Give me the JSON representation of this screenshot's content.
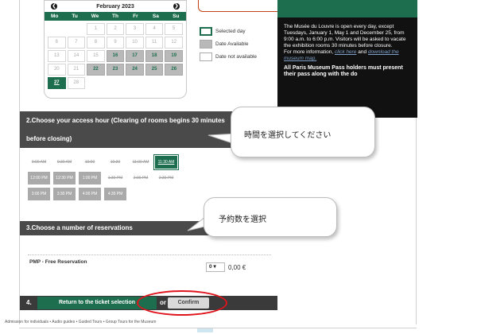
{
  "calendar": {
    "month_title": "February 2023",
    "prev_glyph": "❮",
    "next_glyph": "❯",
    "days_of_week": [
      "Mo",
      "Tu",
      "We",
      "Th",
      "Fr",
      "Sa",
      "Su"
    ],
    "weeks": [
      [
        {
          "d": "",
          "s": "blank"
        },
        {
          "d": "",
          "s": "blank"
        },
        {
          "d": "1",
          "s": "na"
        },
        {
          "d": "2",
          "s": "na"
        },
        {
          "d": "3",
          "s": "na"
        },
        {
          "d": "4",
          "s": "na"
        },
        {
          "d": "5",
          "s": "na"
        }
      ],
      [
        {
          "d": "6",
          "s": "na"
        },
        {
          "d": "7",
          "s": "na"
        },
        {
          "d": "8",
          "s": "na"
        },
        {
          "d": "9",
          "s": "na"
        },
        {
          "d": "10",
          "s": "na"
        },
        {
          "d": "11",
          "s": "na"
        },
        {
          "d": "12",
          "s": "na"
        }
      ],
      [
        {
          "d": "13",
          "s": "na"
        },
        {
          "d": "14",
          "s": "na"
        },
        {
          "d": "15",
          "s": "na"
        },
        {
          "d": "16",
          "s": "avail"
        },
        {
          "d": "17",
          "s": "avail"
        },
        {
          "d": "18",
          "s": "avail"
        },
        {
          "d": "19",
          "s": "avail"
        }
      ],
      [
        {
          "d": "20",
          "s": "na"
        },
        {
          "d": "21",
          "s": "na"
        },
        {
          "d": "22",
          "s": "avail"
        },
        {
          "d": "23",
          "s": "avail"
        },
        {
          "d": "24",
          "s": "avail"
        },
        {
          "d": "25",
          "s": "avail"
        },
        {
          "d": "26",
          "s": "avail"
        }
      ],
      [
        {
          "d": "27",
          "s": "sel"
        },
        {
          "d": "28",
          "s": "na"
        },
        {
          "d": "",
          "s": "blank"
        },
        {
          "d": "",
          "s": "blank"
        },
        {
          "d": "",
          "s": "blank"
        },
        {
          "d": "",
          "s": "blank"
        },
        {
          "d": "",
          "s": "blank"
        }
      ]
    ]
  },
  "legend": {
    "selected": "Selected day",
    "available": "Date Available",
    "not_available": "Date not available"
  },
  "info_panel": {
    "text": "The Musée du Louvre is open every day, except Tuesdays, January 1, May 1 and December 25, from 9:00 a.m. to 6:00 p.m. Visitors will be asked to vacate the exhibition rooms 30 minutes before closure.",
    "more_prefix": "For more information,",
    "click_link": "click here",
    "and_text": "and",
    "download_link": "download the museum map.",
    "pass_note": "All Paris Museum Pass holders must present their pass along with the do"
  },
  "section2": {
    "line1": "2.Choose your access hour (Clearing of rooms begins 30 minutes",
    "line2": "before closing)"
  },
  "time_slots": [
    [
      {
        "t": "9:00 AM",
        "s": "na"
      },
      {
        "t": "9:30 AM",
        "s": "na"
      },
      {
        "t": "10:00",
        "s": "na"
      },
      {
        "t": "10:30",
        "s": "na"
      },
      {
        "t": "11:00 AM",
        "s": "na"
      },
      {
        "t": "11:30 AM",
        "s": "sel"
      }
    ],
    [
      {
        "t": "12:00 PM",
        "s": "open"
      },
      {
        "t": "12:30 PM",
        "s": "open"
      },
      {
        "t": "1:00 PM",
        "s": "open"
      },
      {
        "t": "1:30 PM",
        "s": "na"
      },
      {
        "t": "2:00 PM",
        "s": "na"
      },
      {
        "t": "2:30 PM",
        "s": "na"
      }
    ],
    [
      {
        "t": "3:00 PM",
        "s": "open"
      },
      {
        "t": "3:30 PM",
        "s": "open"
      },
      {
        "t": "4:00 PM",
        "s": "open"
      },
      {
        "t": "4:30 PM",
        "s": "open"
      }
    ]
  ],
  "section3": {
    "title": "3.Choose a number of reservations"
  },
  "reservation": {
    "label": "PMP - Free Reservation",
    "quantity": "0",
    "quantity_caret": "▾",
    "price": "0,00 €"
  },
  "step4": {
    "number": "4.",
    "return_label": "Return to the ticket selection",
    "or_label": "or",
    "confirm_label": "Confirm"
  },
  "footer": {
    "text": "Admission for individuals  •  Audio guides  •  Guided Tours  •  Group Tours for the Museum"
  },
  "callouts": {
    "time": "時間を選択してください",
    "reservations": "予約数を選択"
  },
  "colors": {
    "accent_green": "#1d6e4f",
    "annotation_red": "#e0141d",
    "dark_panel": "#111111",
    "section_bar": "#4a4a4a"
  }
}
